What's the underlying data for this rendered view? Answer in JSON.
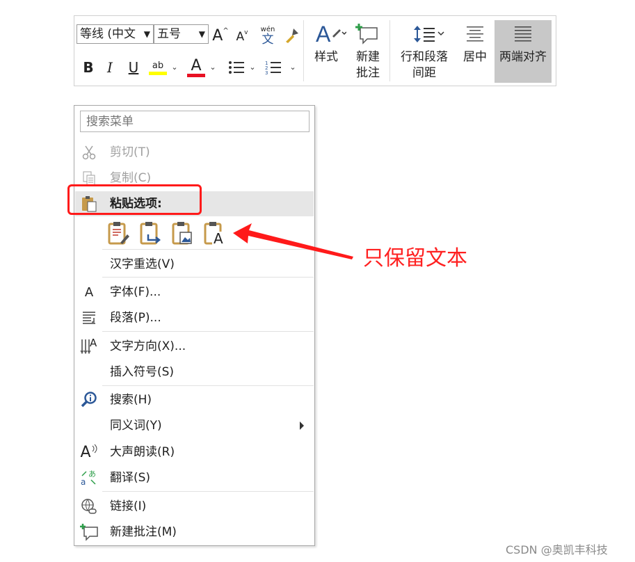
{
  "toolbar": {
    "font_name": "等线 (中文",
    "font_size": "五号",
    "grow_font": "A",
    "shrink_font": "A",
    "phonetic_top": "wén",
    "phonetic_bottom": "文",
    "bold": "B",
    "italic": "I",
    "underline": "U",
    "highlight_glyph": "ab",
    "font_color_glyph": "A",
    "styles_label": "样式",
    "new_comment_line1": "新建",
    "new_comment_line2": "批注",
    "spacing_line1": "行和段落",
    "spacing_line2": "间距",
    "center_label": "居中",
    "justify_label": "两端对齐",
    "highlight_color": "#ffff00",
    "font_color": "#e81123",
    "selected_bg": "#c8c8c8"
  },
  "menu": {
    "search_placeholder": "搜索菜单",
    "items": [
      {
        "label": "剪切(T)",
        "icon": "scissors-icon",
        "enabled": false
      },
      {
        "label": "复制(C)",
        "icon": "copy-icon",
        "enabled": false
      },
      {
        "label": "粘贴选项:",
        "icon": "clipboard-icon",
        "enabled": true
      },
      {
        "label": "汉字重选(V)",
        "icon": "",
        "enabled": true
      },
      {
        "label": "字体(F)...",
        "icon": "font-icon",
        "enabled": true
      },
      {
        "label": "段落(P)...",
        "icon": "paragraph-icon",
        "enabled": true
      },
      {
        "label": "文字方向(X)...",
        "icon": "text-direction-icon",
        "enabled": true
      },
      {
        "label": "插入符号(S)",
        "icon": "",
        "enabled": true
      },
      {
        "label": "搜索(H)",
        "icon": "search-icon",
        "enabled": true
      },
      {
        "label": "同义词(Y)",
        "icon": "",
        "enabled": true
      },
      {
        "label": "大声朗读(R)",
        "icon": "read-aloud-icon",
        "enabled": true
      },
      {
        "label": "翻译(S)",
        "icon": "translate-icon",
        "enabled": true
      },
      {
        "label": "链接(I)",
        "icon": "link-icon",
        "enabled": true
      },
      {
        "label": "新建批注(M)",
        "icon": "new-comment-icon",
        "enabled": true
      }
    ],
    "paste_options": [
      "keep-source-formatting",
      "merge-formatting",
      "picture",
      "keep-text-only"
    ],
    "paste_text_only_glyph": "A",
    "font_glyph": "A",
    "read_aloud_glyph": "A",
    "text_direction_glyph": "A"
  },
  "annotation": {
    "note": "只保留文本",
    "color": "#ff1a1a"
  },
  "watermark": "CSDN @奥凯丰科技"
}
